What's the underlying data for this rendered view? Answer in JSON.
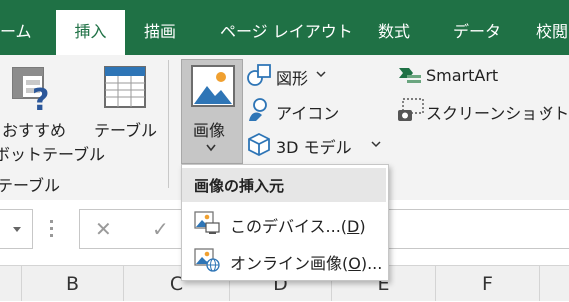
{
  "colors": {
    "excel_green": "#1f7145",
    "ribbon_bg": "#f3f3f3",
    "pressed_bg": "#c6c6c6"
  },
  "tabs": [
    {
      "label": "ーム",
      "active": false
    },
    {
      "label": "挿入",
      "active": true
    },
    {
      "label": "描画",
      "active": false
    },
    {
      "label": "ページ レイアウト",
      "active": false
    },
    {
      "label": "数式",
      "active": false
    },
    {
      "label": "データ",
      "active": false
    },
    {
      "label": "校閲",
      "active": false
    }
  ],
  "ribbon": {
    "recommended_pivot": {
      "line1": "おすすめ",
      "line2": "ボットテーブル",
      "icon": "recommended-pivot-icon"
    },
    "table": {
      "label": "テーブル",
      "icon": "table-icon"
    },
    "group_label": "テーブル",
    "pictures": {
      "label": "画像",
      "icon": "picture-icon"
    },
    "shapes": {
      "label": "図形",
      "icon": "shapes-icon"
    },
    "icons": {
      "label": "アイコン",
      "icon": "icons-icon"
    },
    "models3d": {
      "label": "3D モデル",
      "icon": "cube-icon"
    },
    "smartart": {
      "label": "SmartArt",
      "icon": "smartart-icon"
    },
    "screenshot": {
      "label": "スクリーンショット",
      "icon": "screenshot-icon"
    }
  },
  "formula_bar": {
    "cancel": "✕",
    "enter": "✓"
  },
  "columns": [
    "B",
    "C",
    "D",
    "E",
    "F"
  ],
  "picture_menu": {
    "header": "画像の挿入元",
    "items": [
      {
        "before": "このデバイス...(",
        "key": "D",
        "after": ")",
        "icon": "device-picture-icon"
      },
      {
        "before": "オンライン画像(",
        "key": "O",
        "after": ")...",
        "icon": "online-picture-icon"
      }
    ]
  }
}
